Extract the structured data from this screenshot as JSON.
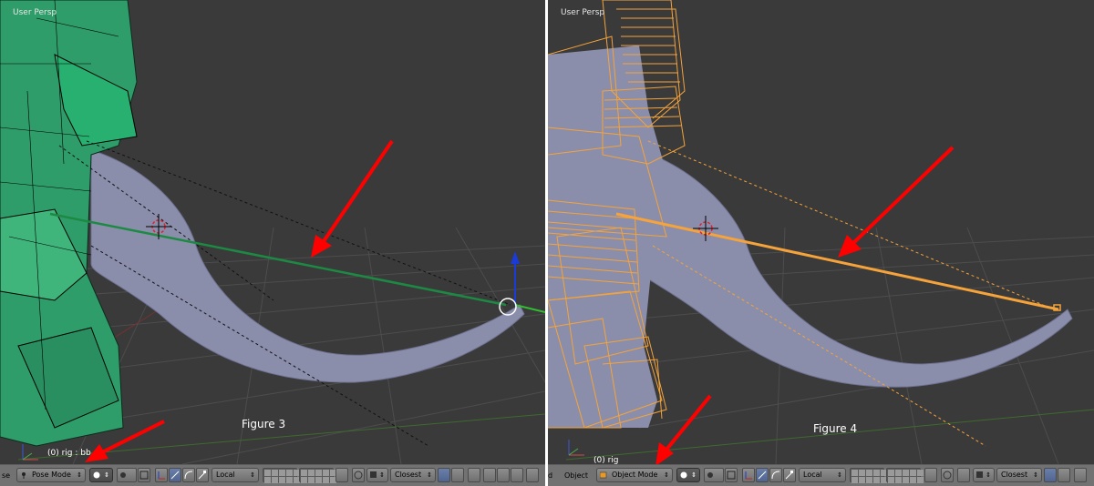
{
  "figures": [
    {
      "viewport_label": "User Persp",
      "caption": "Figure 3",
      "status": "(0) rig : bb_t",
      "header": {
        "left_clip_text": "se",
        "mode": "Pose Mode",
        "mode_icon": "pose-mode-icon",
        "pivot": "Local",
        "snap": "Closest"
      }
    },
    {
      "viewport_label": "User Persp",
      "caption": "Figure 4",
      "status": "(0) rig",
      "header": {
        "left_clip_text": "d",
        "menu_object": "Object",
        "mode": "Object Mode",
        "mode_icon": "object-mode-icon",
        "pivot": "Local",
        "snap": "Closest"
      }
    }
  ],
  "colors": {
    "viewport_bg": "#3a3a3a",
    "grid": "#505050",
    "mesh": "#8f92b0",
    "pose_bone": "#2fa66f",
    "object_wire": "#f5a33a",
    "annotation_arrow": "#ff0000",
    "header_bg": "#727272"
  }
}
